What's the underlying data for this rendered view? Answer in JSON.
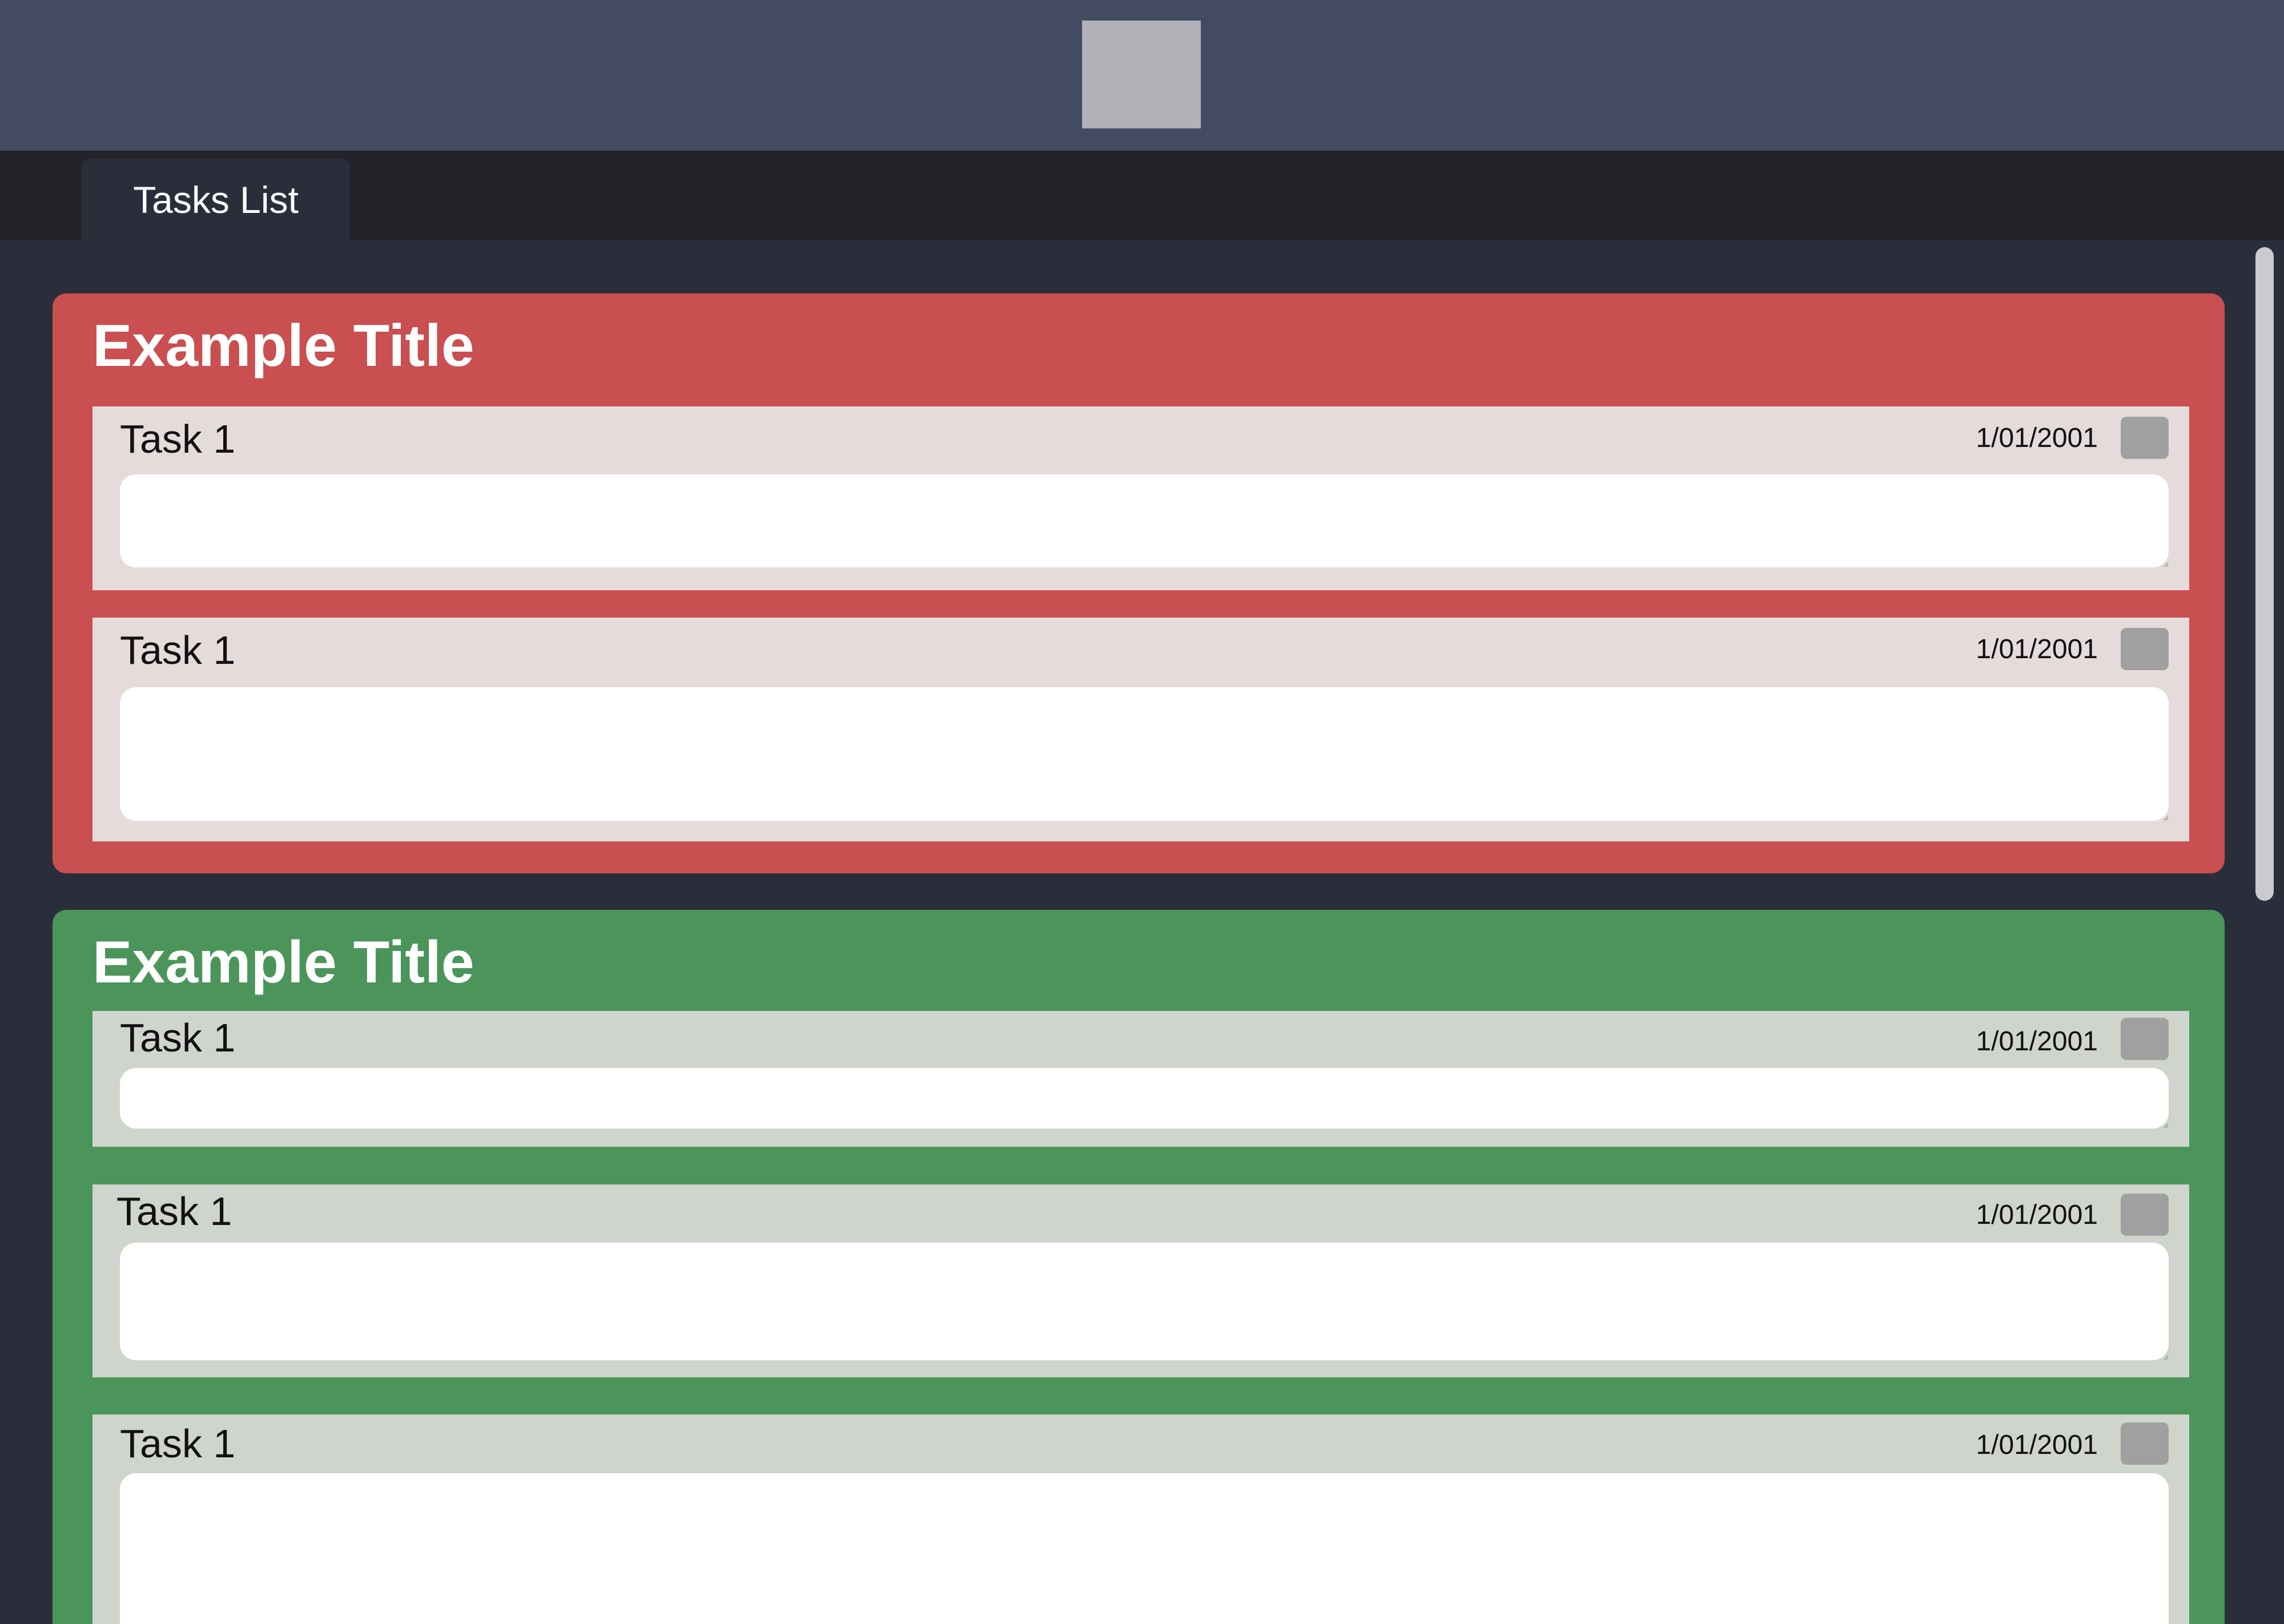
{
  "tabs": [
    {
      "label": "Tasks List"
    }
  ],
  "groups": [
    {
      "title": "Example Title",
      "color": "#c94f50",
      "task_bg": "#e4dbda",
      "tasks": [
        {
          "name": "Task 1",
          "date": "1/01/2001",
          "notes": ""
        },
        {
          "name": "Task 1",
          "date": "1/01/2001",
          "notes": ""
        }
      ]
    },
    {
      "title": "Example Title",
      "color": "#4b955b",
      "task_bg": "#cfd5cd",
      "tasks": [
        {
          "name": "Task 1",
          "date": "1/01/2001",
          "notes": ""
        },
        {
          "name": "Task 1",
          "date": "1/01/2001",
          "notes": ""
        },
        {
          "name": "Task 1",
          "date": "1/01/2001",
          "notes": ""
        }
      ]
    }
  ]
}
